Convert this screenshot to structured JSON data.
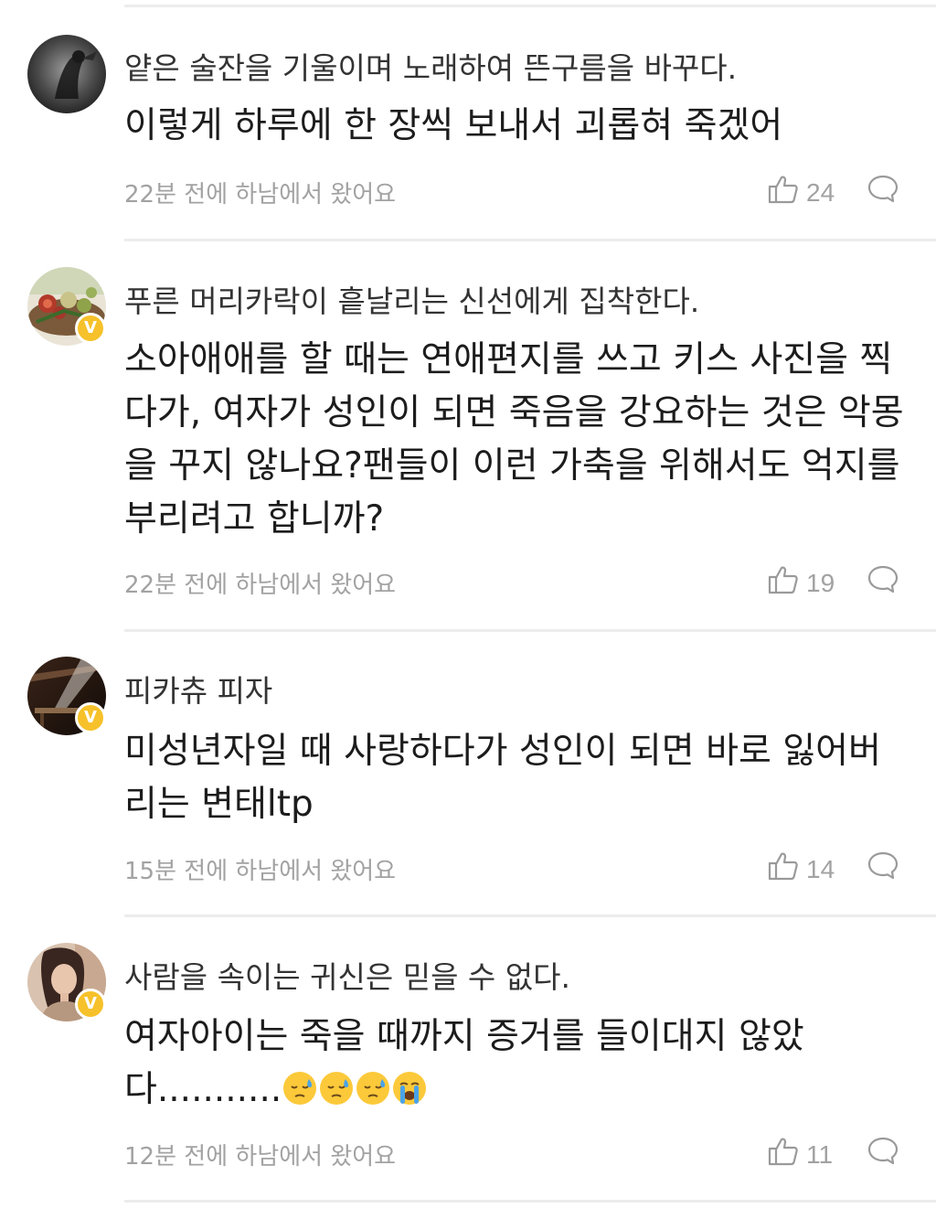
{
  "comments": [
    {
      "username": "얕은 술잔을 기울이며 노래하여 뜬구름을 바꾸다.",
      "lines": [
        "이렇게 하루에 한 장씩 보내서 괴롭혀 죽겠어"
      ],
      "meta": "22분 전에 하남에서 왔어요",
      "likes": "24",
      "verified": false
    },
    {
      "username": "푸른 머리카락이 흩날리는 신선에게 집착한다.",
      "lines": [
        "소아애애를 할 때는 연애편지를 쓰고 키스 사진을 찍",
        "다가, 여자가 성인이 되면 죽음을 강요하는 것은 악몽",
        "을 꾸지 않나요?팬들이 이런 가축을 위해서도 억지를",
        "부리려고 합니까?"
      ],
      "meta": "22분 전에 하남에서 왔어요",
      "likes": "19",
      "verified": true,
      "badge": "V"
    },
    {
      "username": "피카츄 피자",
      "lines": [
        "미성년자일 때 사랑하다가 성인이 되면 바로 잃어버",
        "리는 변태ltp"
      ],
      "meta": "15분 전에 하남에서 왔어요",
      "likes": "14",
      "verified": true,
      "badge": "V"
    },
    {
      "username": "사람을 속이는 귀신은 믿을 수 없다.",
      "lines": [
        "여자아이는 죽을 때까지 증거를 들이대지 않았",
        "다..........."
      ],
      "emojis": [
        "sweat-face-emoji",
        "sweat-face-emoji",
        "sweat-face-emoji",
        "crying-face-emoji"
      ],
      "meta": "12분 전에 하남에서 왔어요",
      "likes": "11",
      "verified": true,
      "badge": "V"
    }
  ],
  "colors": {
    "meta_gray": "#a2a2a2",
    "badge_yellow": "#f6c12a",
    "divider": "#ececec"
  },
  "icons": [
    "thumbs-up-icon",
    "reply-bubble-icon",
    "verified-badge-icon"
  ]
}
